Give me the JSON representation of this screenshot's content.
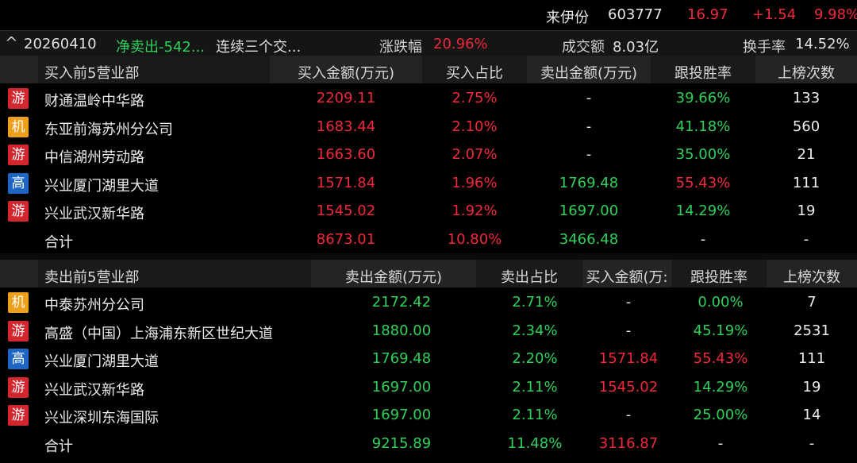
{
  "header": {
    "stock_name": "来伊份",
    "stock_code": "603777",
    "price": "16.97",
    "change": "+1.54",
    "change_pct": "9.98%"
  },
  "summary": {
    "caret": "^",
    "date": "20260410",
    "net": "净卖出-542...",
    "tag": "连续三个交...",
    "chg_label": "涨跌幅",
    "chg_val": "20.96%",
    "amount_label": "成交额",
    "amount_val": "8.03亿",
    "turnover_label": "换手率",
    "turnover_val": "14.52%"
  },
  "buy": {
    "headers": [
      "买入前5营业部",
      "买入金额(万元)",
      "买入占比",
      "卖出金额(万元)",
      "跟投胜率",
      "上榜次数"
    ],
    "rows": [
      {
        "badge": "游",
        "badge_type": "you",
        "name": "财通温岭中华路",
        "buy": "2209.11",
        "ratio": "2.75%",
        "sell": "-",
        "win": "39.66%",
        "count": "133"
      },
      {
        "badge": "机",
        "badge_type": "ji",
        "name": "东亚前海苏州分公司",
        "buy": "1683.44",
        "ratio": "2.10%",
        "sell": "-",
        "win": "41.18%",
        "count": "560"
      },
      {
        "badge": "游",
        "badge_type": "you",
        "name": "中信湖州劳动路",
        "buy": "1663.60",
        "ratio": "2.07%",
        "sell": "-",
        "win": "35.00%",
        "count": "21"
      },
      {
        "badge": "高",
        "badge_type": "gao",
        "name": "兴业厦门湖里大道",
        "buy": "1571.84",
        "ratio": "1.96%",
        "sell": "1769.48",
        "win": "55.43%",
        "count": "111"
      },
      {
        "badge": "游",
        "badge_type": "you",
        "name": "兴业武汉新华路",
        "buy": "1545.02",
        "ratio": "1.92%",
        "sell": "1697.00",
        "win": "14.29%",
        "count": "19"
      }
    ],
    "total": {
      "name": "合计",
      "buy": "8673.01",
      "ratio": "10.80%",
      "sell": "3466.48",
      "win": "-",
      "count": "-"
    }
  },
  "sell": {
    "headers": [
      "卖出前5营业部",
      "卖出金额(万元)",
      "卖出占比",
      "买入金额(万:",
      "跟投胜率",
      "上榜次数"
    ],
    "rows": [
      {
        "badge": "机",
        "badge_type": "ji",
        "name": "中泰苏州分公司",
        "sell": "2172.42",
        "ratio": "2.71%",
        "buy": "-",
        "win": "0.00%",
        "count": "7"
      },
      {
        "badge": "游",
        "badge_type": "you",
        "name": "高盛（中国）上海浦东新区世纪大道",
        "sell": "1880.00",
        "ratio": "2.34%",
        "buy": "-",
        "win": "45.19%",
        "count": "2531"
      },
      {
        "badge": "高",
        "badge_type": "gao",
        "name": "兴业厦门湖里大道",
        "sell": "1769.48",
        "ratio": "2.20%",
        "buy": "1571.84",
        "win": "55.43%",
        "count": "111"
      },
      {
        "badge": "游",
        "badge_type": "you",
        "name": "兴业武汉新华路",
        "sell": "1697.00",
        "ratio": "2.11%",
        "buy": "1545.02",
        "win": "14.29%",
        "count": "19"
      },
      {
        "badge": "游",
        "badge_type": "you",
        "name": "兴业深圳东海国际",
        "sell": "1697.00",
        "ratio": "2.11%",
        "buy": "-",
        "win": "25.00%",
        "count": "14"
      }
    ],
    "total": {
      "name": "合计",
      "sell": "9215.89",
      "ratio": "11.48%",
      "buy": "3116.87",
      "win": "-",
      "count": "-"
    }
  },
  "colors": {
    "up": "#f0283c",
    "down": "#2fd05a",
    "badge_you": "#d4262f",
    "badge_ji": "#eca01c",
    "badge_gao": "#1e66c4"
  }
}
